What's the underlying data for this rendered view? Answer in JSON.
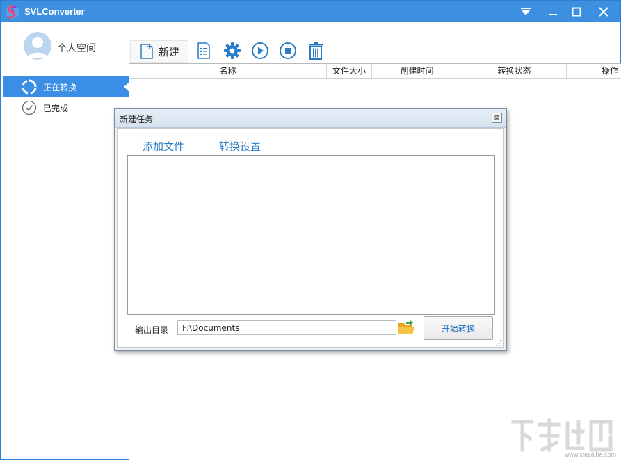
{
  "app": {
    "title": "SVLConverter"
  },
  "sidebar": {
    "user_label": "个人空间",
    "items": [
      {
        "label": "正在转换",
        "active": true
      },
      {
        "label": "已完成",
        "active": false
      }
    ]
  },
  "toolbar": {
    "new_label": "新建"
  },
  "table": {
    "columns": [
      "名称",
      "文件大小",
      "创建时间",
      "转换状态",
      "操作"
    ]
  },
  "dialog": {
    "title": "新建任务",
    "close_glyph": "⊠",
    "tabs": [
      "添加文件",
      "转换设置"
    ],
    "output_label": "输出目录",
    "output_value": "F:\\Documents",
    "start_label": "开始转换"
  },
  "watermark": {
    "url": "www.xiazaiba.com"
  },
  "colors": {
    "accent": "#3a8ee6",
    "titlebar": "#3d8fe0",
    "icon_blue": "#2a7cc7"
  },
  "icons": {
    "toolbar": [
      "new-file-icon",
      "list-icon",
      "gear-icon",
      "play-icon",
      "stop-icon",
      "trash-icon"
    ],
    "titlebar": [
      "dropdown-icon",
      "minimize-icon",
      "maximize-icon",
      "close-icon"
    ]
  }
}
